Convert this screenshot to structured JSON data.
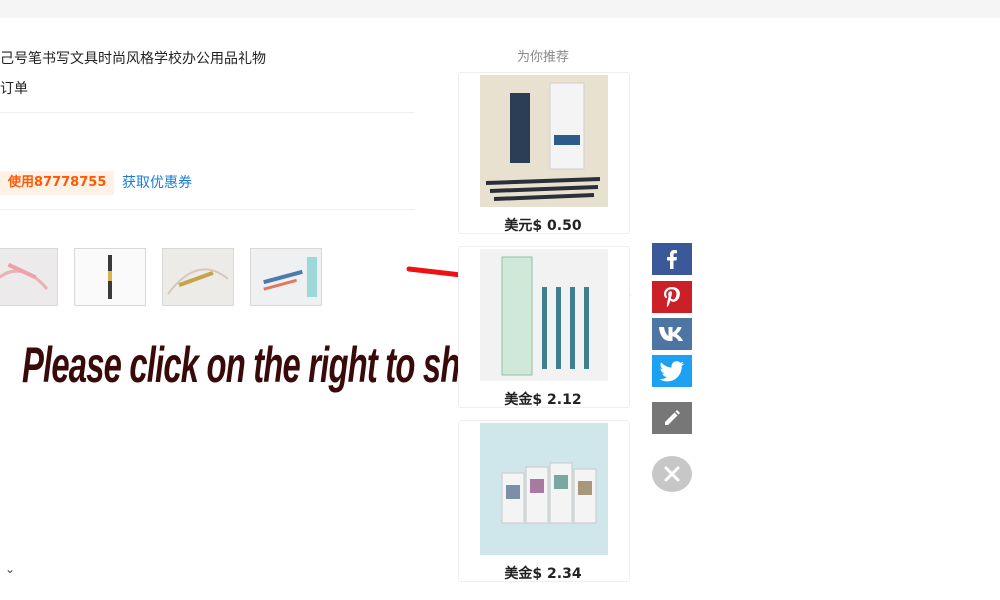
{
  "product": {
    "title_line1": "己号笔书写文具时尚风格学校办公用品礼物",
    "title_line2": "订单"
  },
  "coupon": {
    "tag": "使用87778755",
    "link": "获取优惠券"
  },
  "annotation": {
    "text": "Please click on the right to share"
  },
  "recommend": {
    "title": "为你推荐",
    "items": [
      {
        "price": "美元$ 0.50"
      },
      {
        "price": "美金$ 2.12"
      },
      {
        "price": "美金$ 2.34"
      }
    ]
  },
  "share": {
    "buttons": [
      "facebook-icon",
      "pinterest-icon",
      "vk-icon",
      "twitter-icon",
      "edit-icon",
      "close-icon"
    ]
  },
  "colors": {
    "facebook": "#3b5998",
    "pinterest": "#cb2027",
    "vk": "#4c75a3",
    "twitter": "#1da1f2",
    "coupon_accent": "#ff5a00",
    "link": "#1a7fd6",
    "arrow": "#ee1111"
  }
}
